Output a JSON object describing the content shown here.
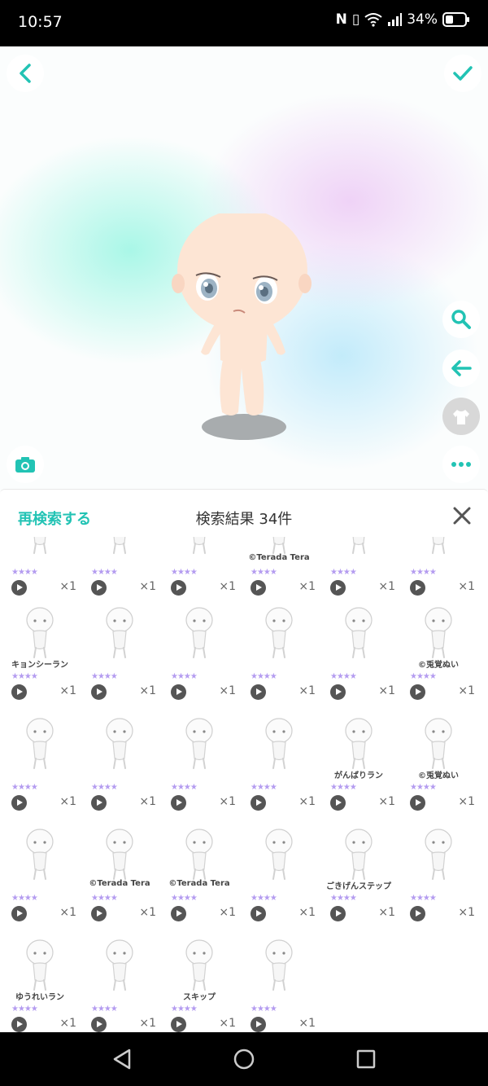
{
  "status_bar": {
    "time": "10:57",
    "battery": "34%"
  },
  "stage": {
    "back_icon": "chevron-left-icon",
    "confirm_icon": "check-icon",
    "tools": [
      "search-icon",
      "undo-arrow-icon",
      "outfit-icon",
      "camera-icon",
      "more-icon"
    ]
  },
  "panel": {
    "research_label": "再検索する",
    "result_title": "検索結果 34件",
    "items": [
      {
        "label": "",
        "stars": "★★★★",
        "qty": "×1"
      },
      {
        "label": "",
        "stars": "★★★★",
        "qty": "×1"
      },
      {
        "label": "",
        "stars": "★★★★",
        "qty": "×1"
      },
      {
        "label": "©Terada Tera",
        "stars": "★★★★",
        "qty": "×1"
      },
      {
        "label": "",
        "stars": "★★★★",
        "qty": "×1"
      },
      {
        "label": "",
        "stars": "★★★★",
        "qty": "×1"
      },
      {
        "label": "キョンシーラン",
        "stars": "★★★★",
        "qty": "×1"
      },
      {
        "label": "",
        "stars": "★★★★",
        "qty": "×1"
      },
      {
        "label": "",
        "stars": "★★★★",
        "qty": "×1"
      },
      {
        "label": "",
        "stars": "★★★★",
        "qty": "×1"
      },
      {
        "label": "",
        "stars": "★★★★",
        "qty": "×1"
      },
      {
        "label": "©兎覚ぬい",
        "stars": "★★★★",
        "qty": "×1"
      },
      {
        "label": "",
        "stars": "★★★★",
        "qty": "×1"
      },
      {
        "label": "",
        "stars": "★★★★",
        "qty": "×1"
      },
      {
        "label": "",
        "stars": "★★★★",
        "qty": "×1"
      },
      {
        "label": "",
        "stars": "★★★★",
        "qty": "×1"
      },
      {
        "label": "がんばりラン",
        "stars": "★★★★",
        "qty": "×1"
      },
      {
        "label": "©兎覚ぬい",
        "stars": "★★★★",
        "qty": "×1"
      },
      {
        "label": "",
        "stars": "★★★★",
        "qty": "×1"
      },
      {
        "label": "©Terada Tera",
        "stars": "★★★★",
        "qty": "×1"
      },
      {
        "label": "©Terada Tera",
        "stars": "★★★★",
        "qty": "×1"
      },
      {
        "label": "",
        "stars": "★★★★",
        "qty": "×1"
      },
      {
        "label": "ごきげんステップ",
        "stars": "★★★★",
        "qty": "×1"
      },
      {
        "label": "",
        "stars": "★★★★",
        "qty": "×1"
      },
      {
        "label": "ゆうれいラン",
        "stars": "★★★★",
        "qty": "×1"
      },
      {
        "label": "",
        "stars": "★★★★",
        "qty": "×1"
      },
      {
        "label": "スキップ",
        "stars": "★★★★",
        "qty": "×1"
      },
      {
        "label": "",
        "stars": "★★★★",
        "qty": "×1"
      }
    ]
  },
  "nav": {
    "back_icon": "nav-back-icon",
    "home_icon": "nav-home-icon",
    "recents_icon": "nav-recents-icon"
  },
  "colors": {
    "accent": "#22c3b4",
    "stars": "#b49cf0"
  }
}
